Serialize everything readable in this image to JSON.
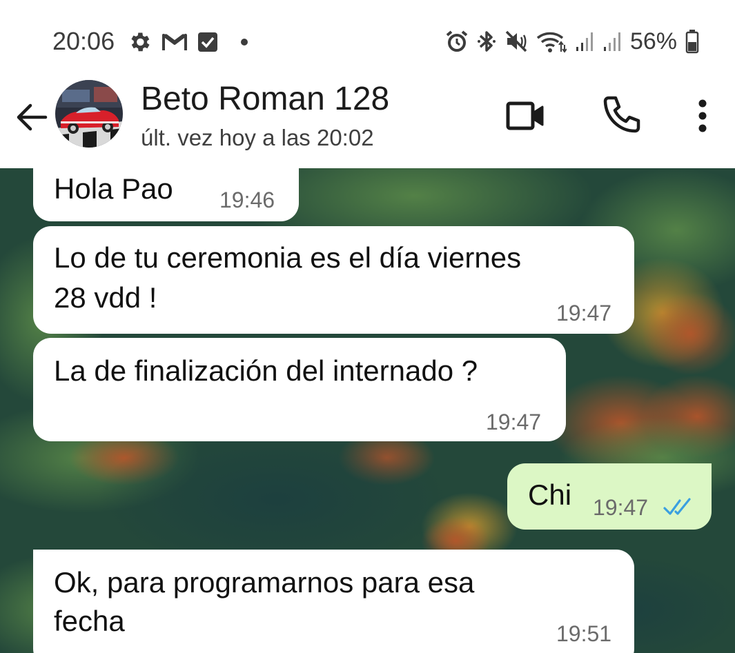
{
  "status_bar": {
    "time": "20:06",
    "battery_percent": "56%",
    "left_icons": [
      "settings-gear-icon",
      "gmail-icon",
      "checkbox-icon",
      "dot-icon"
    ],
    "right_icons": [
      "alarm-icon",
      "bluetooth-icon",
      "mute-icon",
      "wifi-icon",
      "signal-icon",
      "signal-icon",
      "battery-icon"
    ]
  },
  "header": {
    "contact_name": "Beto Roman 128",
    "last_seen": "últ. vez hoy a las 20:02",
    "icons": [
      "back-arrow-icon",
      "video-camera-icon",
      "phone-icon",
      "more-vert-icon"
    ]
  },
  "messages": [
    {
      "direction": "incoming",
      "text_lines": [
        "Hola Pao"
      ],
      "time": "19:46"
    },
    {
      "direction": "incoming",
      "text_lines": [
        "Lo de tu ceremonia es el día viernes",
        "28 vdd !"
      ],
      "time": "19:47"
    },
    {
      "direction": "incoming",
      "text_lines": [
        "La de finalización del internado ?"
      ],
      "time": "19:47"
    },
    {
      "direction": "outgoing",
      "text_lines": [
        "Chi"
      ],
      "time": "19:47",
      "status": "read"
    },
    {
      "direction": "incoming",
      "text_lines": [
        "Ok, para programarnos para esa",
        "fecha"
      ],
      "time": "19:51"
    }
  ],
  "colors": {
    "incoming_bubble": "#ffffff",
    "outgoing_bubble": "#dcf7c5",
    "read_ticks": "#3a9fe0",
    "chat_background": "#1f4536"
  }
}
